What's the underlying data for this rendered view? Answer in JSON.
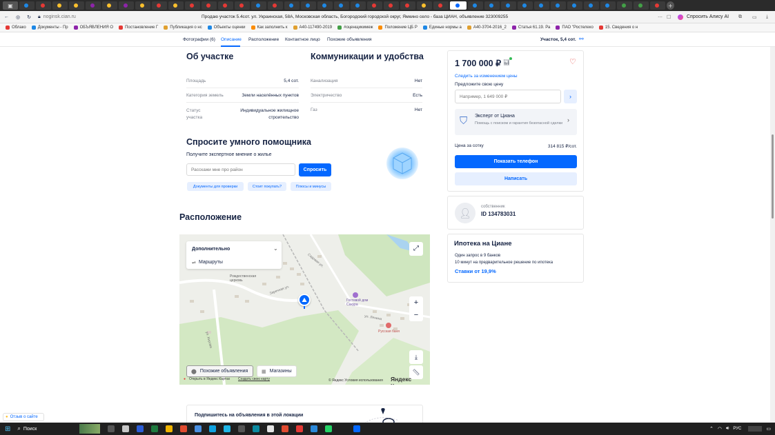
{
  "browser": {
    "url": "noginsk.cian.ru",
    "page_title": "Продаю участок 5.4сот. ул. Украинская, 58А, Московская область, Богородский городской округ, Ямкино село - база ЦИАН, объявление 323009255",
    "alice_label": "Спросить Алису AI",
    "bookmarks": [
      "Облако",
      "Документы - Пр",
      "ОБЪЯВЛЕНИЯ О",
      "Постановление Г",
      "Публикация о нс",
      "Объекты оценки",
      "Как заполнить к",
      "А40-117490-2019",
      "#оценщикимеж",
      "Положение ЦБ Р",
      "Единые нормы а",
      "А40-3704-2016_2",
      "Статья 61.19. Ра",
      "ПАО \"Ростелеко",
      "15. Сведения о н"
    ]
  },
  "nav": {
    "items": [
      "Фотографии (6)",
      "Описание",
      "Расположение",
      "Контактное лицо",
      "Похожие объявления"
    ],
    "right_label": "Участок, 5,4 сот."
  },
  "about": {
    "title": "Об участке",
    "rows": [
      {
        "label": "Площадь",
        "value": "5,4 сот."
      },
      {
        "label": "Категория земель",
        "value": "Земли населённых пунктов"
      },
      {
        "label": "Статус участка",
        "value": "Индивидуальное жилищное строительство"
      }
    ]
  },
  "utilities": {
    "title": "Коммуникации и удобства",
    "rows": [
      {
        "label": "Канализация",
        "value": "Нет"
      },
      {
        "label": "Электричество",
        "value": "Есть"
      },
      {
        "label": "Газ",
        "value": "Нет"
      }
    ]
  },
  "assistant": {
    "title": "Спросите умного помощника",
    "subtitle": "Получите экспертное мнение о жилье",
    "placeholder": "Расскажи мне про район",
    "button": "Спросить",
    "chips": [
      "Документы для проверки",
      "Стоит покупать?",
      "Плюсы и минусы"
    ]
  },
  "location": {
    "title": "Расположение",
    "panel_dropdown": "Дополнительно",
    "routes": "Маршруты",
    "bottom_buttons": [
      "Похожие объявления",
      "Магазины"
    ],
    "open_in_yandex": "Открыть в Яндекс Картах",
    "create_map": "Создать свою карту",
    "terms": "© Яндекс Условия использования",
    "logo": "Яндекс Карты",
    "map_labels": [
      "Рождественская церковь",
      "Гостевой дом Сакура",
      "Русская баня",
      "ул. Кирова",
      "Садовая ул.",
      "ул. Ленина",
      "Заречная ул."
    ]
  },
  "subscribe": {
    "text": "Подпишитесь на объявления в этой локации"
  },
  "price_card": {
    "price": "1 700 000 ₽",
    "follow": "Следить за изменением цены",
    "offer_label": "Предложите свою цену",
    "offer_placeholder": "Например, 1 649 000 ₽",
    "expert_title": "Эксперт от Циана",
    "expert_sub": "Помощь с поиском и гарантия безопасной сделки",
    "per_unit_label": "Цена за сотку",
    "per_unit_value": "314 815 ₽/сот.",
    "show_phone": "Показать телефон",
    "write": "Написать"
  },
  "owner": {
    "role": "собственник",
    "id": "ID 134783031"
  },
  "mortgage": {
    "title": "Ипотека на Циане",
    "line1": "Один запрос в 9 банков",
    "line2": "10 минут на предварительное решение по ипотека",
    "rate": "Ставки от 19,9%"
  },
  "feedback": "Отзыв о сайте",
  "taskbar": {
    "search": "Поиск",
    "lang": "РУС"
  },
  "colors": {
    "accent": "#0468ff",
    "text": "#152242",
    "muted": "#7a7f8a"
  }
}
